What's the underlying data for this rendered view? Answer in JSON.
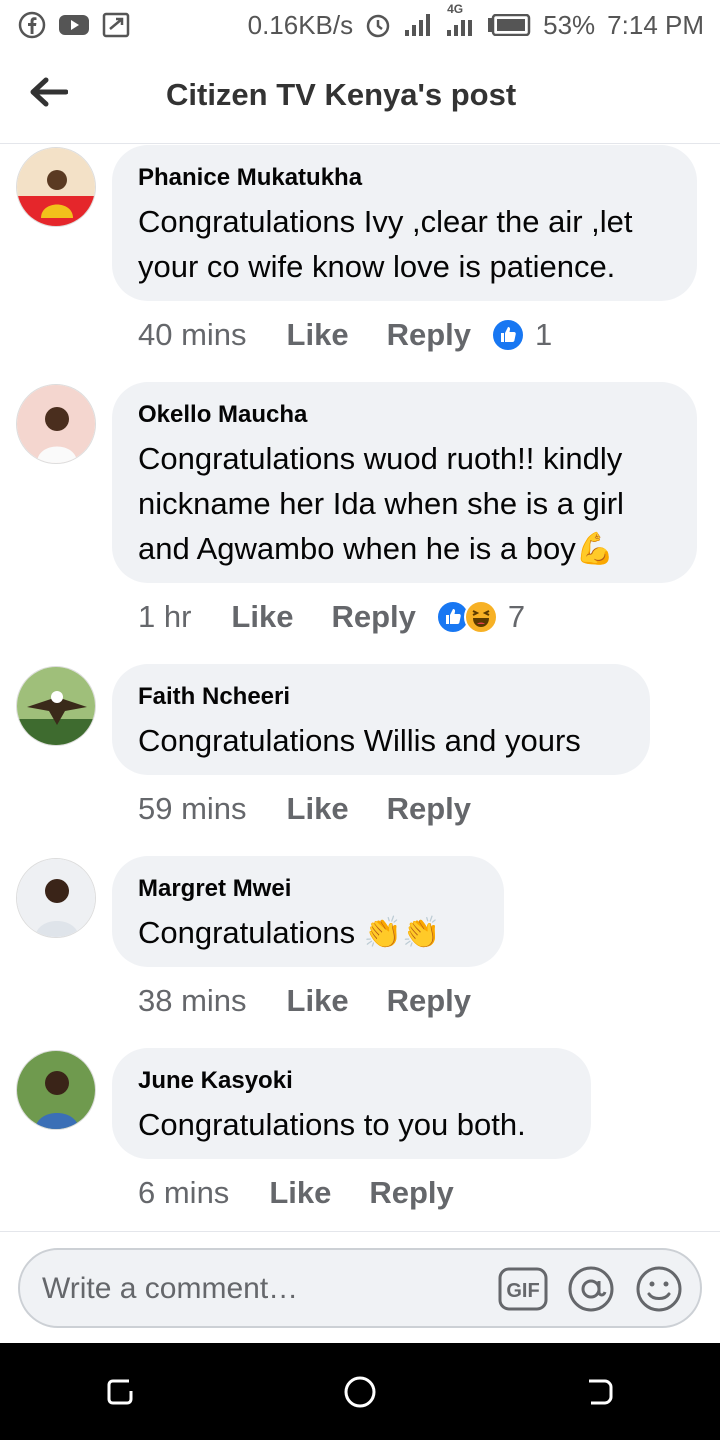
{
  "status_bar": {
    "net_speed": "0.16KB/s",
    "network_type": "4G",
    "battery": "53%",
    "time": "7:14 PM"
  },
  "header": {
    "title": "Citizen TV Kenya's post",
    "back_icon": "arrow-left-icon"
  },
  "comments": [
    {
      "author": "Phanice Mukatukha",
      "lines": [
        "Congratulations Ivy ,clear the air ,let",
        "your co wife know love is patience."
      ],
      "time": "40 mins",
      "like_label": "Like",
      "reply_label": "Reply",
      "reactions": [
        "like-reaction-icon"
      ],
      "reaction_count": "1"
    },
    {
      "author": "Okello Maucha",
      "lines": [
        "Congratulations wuod ruoth!! kindly",
        "nickname her Ida when she is a girl",
        "and Agwambo when he is a boy💪"
      ],
      "time": "1 hr",
      "like_label": "Like",
      "reply_label": "Reply",
      "reactions": [
        "like-reaction-icon",
        "haha-reaction-icon"
      ],
      "reaction_count": "7"
    },
    {
      "author": "Faith Ncheeri",
      "lines": [
        "Congratulations Willis and yours"
      ],
      "time": "59 mins",
      "like_label": "Like",
      "reply_label": "Reply"
    },
    {
      "author": "Margret Mwei",
      "lines": [
        "Congratulations 👏👏"
      ],
      "time": "38 mins",
      "like_label": "Like",
      "reply_label": "Reply"
    },
    {
      "author": "June Kasyoki",
      "lines": [
        "Congratulations to you both."
      ],
      "time": "6 mins",
      "like_label": "Like",
      "reply_label": "Reply"
    }
  ],
  "composer": {
    "placeholder": "Write a comment…",
    "gif_label": "GIF",
    "icons": [
      "gif-icon",
      "mention-icon",
      "emoji-icon"
    ]
  },
  "colors": {
    "bubble_bg": "#f0f2f5",
    "like_blue": "#1877f2",
    "meta_gray": "#65676b"
  }
}
